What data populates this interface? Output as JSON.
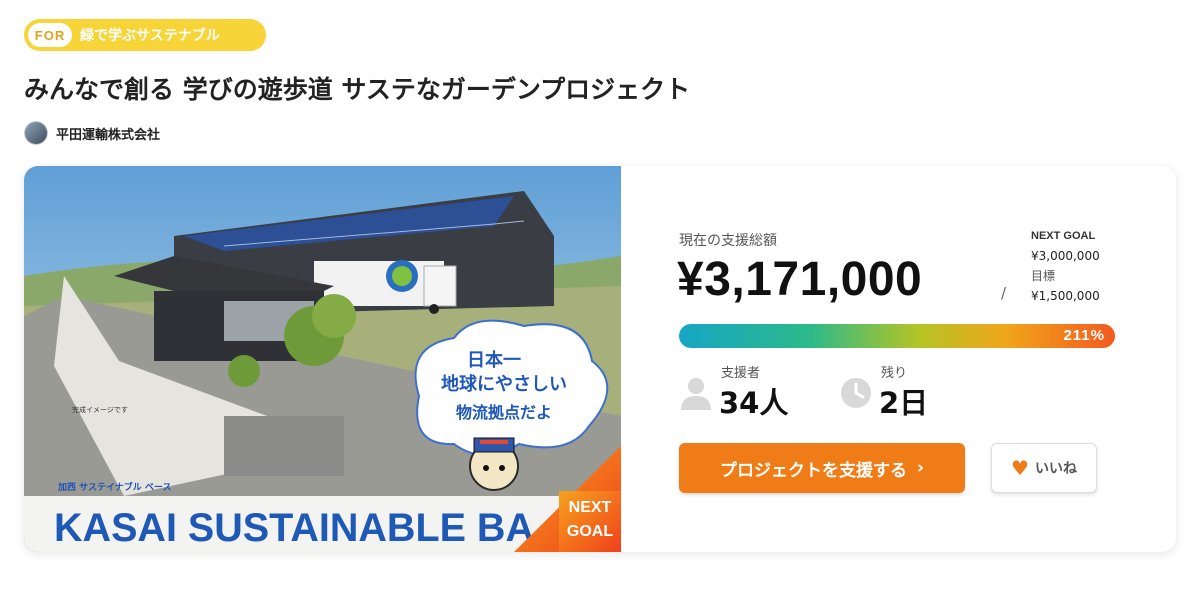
{
  "tag": {
    "prefix": "FOR",
    "category": "緑で学ぶサステナブル"
  },
  "project": {
    "title": "みんなで創る 学びの遊歩道 サステなガーデンプロジェクト",
    "owner": "平田運輸株式会社"
  },
  "hero": {
    "caption_small": "完成イメージです",
    "bubble_line1": "日本一",
    "bubble_line2": "地球にやさしい",
    "bubble_line3": "物流拠点だよ",
    "subtitle_jp": "加西 サステイナブル ベース",
    "title_en": "KASAI SUSTAINABLE BA",
    "badge_line1": "NEXT",
    "badge_line2": "GOAL"
  },
  "stats": {
    "total_label": "現在の支援総額",
    "total_amount": "¥3,171,000",
    "next_goal_label": "NEXT GOAL",
    "next_goal_amount": "¥3,000,000",
    "target_label": "目標",
    "target_amount": "¥1,500,000",
    "separator": "/",
    "progress_percent": 211,
    "progress_text": "211%",
    "supporters_label": "支援者",
    "supporters_value": "34人",
    "remaining_label": "残り",
    "remaining_value": "2日"
  },
  "actions": {
    "support_label": "プロジェクトを支援する",
    "support_chevron": "›",
    "like_label": "いいね"
  },
  "colors": {
    "tag_bg": "#f7d538",
    "cta": "#f07c17",
    "progress_start": "#16a6c4",
    "progress_end": "#f25a1f"
  },
  "icons": [
    "person-icon",
    "clock-icon",
    "heart-icon",
    "chevron-right-icon",
    "avatar"
  ]
}
